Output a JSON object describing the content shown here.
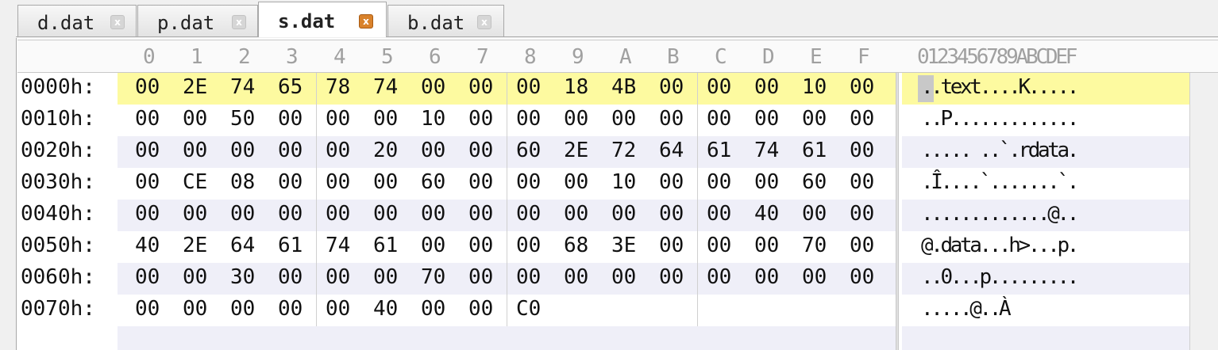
{
  "tabs": [
    {
      "label": "d.dat",
      "active": false
    },
    {
      "label": "p.dat",
      "active": false
    },
    {
      "label": "s.dat",
      "active": true
    },
    {
      "label": "b.dat",
      "active": false
    }
  ],
  "close_glyph": "x",
  "column_headers": [
    "0",
    "1",
    "2",
    "3",
    "4",
    "5",
    "6",
    "7",
    "8",
    "9",
    "A",
    "B",
    "C",
    "D",
    "E",
    "F"
  ],
  "ascii_header": "0123456789ABCDEF",
  "rows": [
    {
      "address": "0000h:",
      "bytes": [
        "00",
        "2E",
        "74",
        "65",
        "78",
        "74",
        "00",
        "00",
        "00",
        "18",
        "4B",
        "00",
        "00",
        "00",
        "10",
        "00"
      ],
      "ascii": "..text....K....."
    },
    {
      "address": "0010h:",
      "bytes": [
        "00",
        "00",
        "50",
        "00",
        "00",
        "00",
        "10",
        "00",
        "00",
        "00",
        "00",
        "00",
        "00",
        "00",
        "00",
        "00"
      ],
      "ascii": "..P............."
    },
    {
      "address": "0020h:",
      "bytes": [
        "00",
        "00",
        "00",
        "00",
        "00",
        "20",
        "00",
        "00",
        "60",
        "2E",
        "72",
        "64",
        "61",
        "74",
        "61",
        "00"
      ],
      "ascii": "..... ..`.rdata."
    },
    {
      "address": "0030h:",
      "bytes": [
        "00",
        "CE",
        "08",
        "00",
        "00",
        "00",
        "60",
        "00",
        "00",
        "00",
        "10",
        "00",
        "00",
        "00",
        "60",
        "00"
      ],
      "ascii": ".Î....`.......`."
    },
    {
      "address": "0040h:",
      "bytes": [
        "00",
        "00",
        "00",
        "00",
        "00",
        "00",
        "00",
        "00",
        "00",
        "00",
        "00",
        "00",
        "00",
        "40",
        "00",
        "00"
      ],
      "ascii": ".............@.."
    },
    {
      "address": "0050h:",
      "bytes": [
        "40",
        "2E",
        "64",
        "61",
        "74",
        "61",
        "00",
        "00",
        "00",
        "68",
        "3E",
        "00",
        "00",
        "00",
        "70",
        "00"
      ],
      "ascii": "@.data...h>...p."
    },
    {
      "address": "0060h:",
      "bytes": [
        "00",
        "00",
        "30",
        "00",
        "00",
        "00",
        "70",
        "00",
        "00",
        "00",
        "00",
        "00",
        "00",
        "00",
        "00",
        "00"
      ],
      "ascii": "..0...p........."
    },
    {
      "address": "0070h:",
      "bytes": [
        "00",
        "00",
        "00",
        "00",
        "00",
        "40",
        "00",
        "00",
        "C0"
      ],
      "ascii": ".....@..À"
    }
  ],
  "colors": {
    "highlight_row": "#fdfaa0",
    "alt_row": "#efeff8",
    "active_close": "#d9822b",
    "header_text": "#a0a0a0"
  }
}
